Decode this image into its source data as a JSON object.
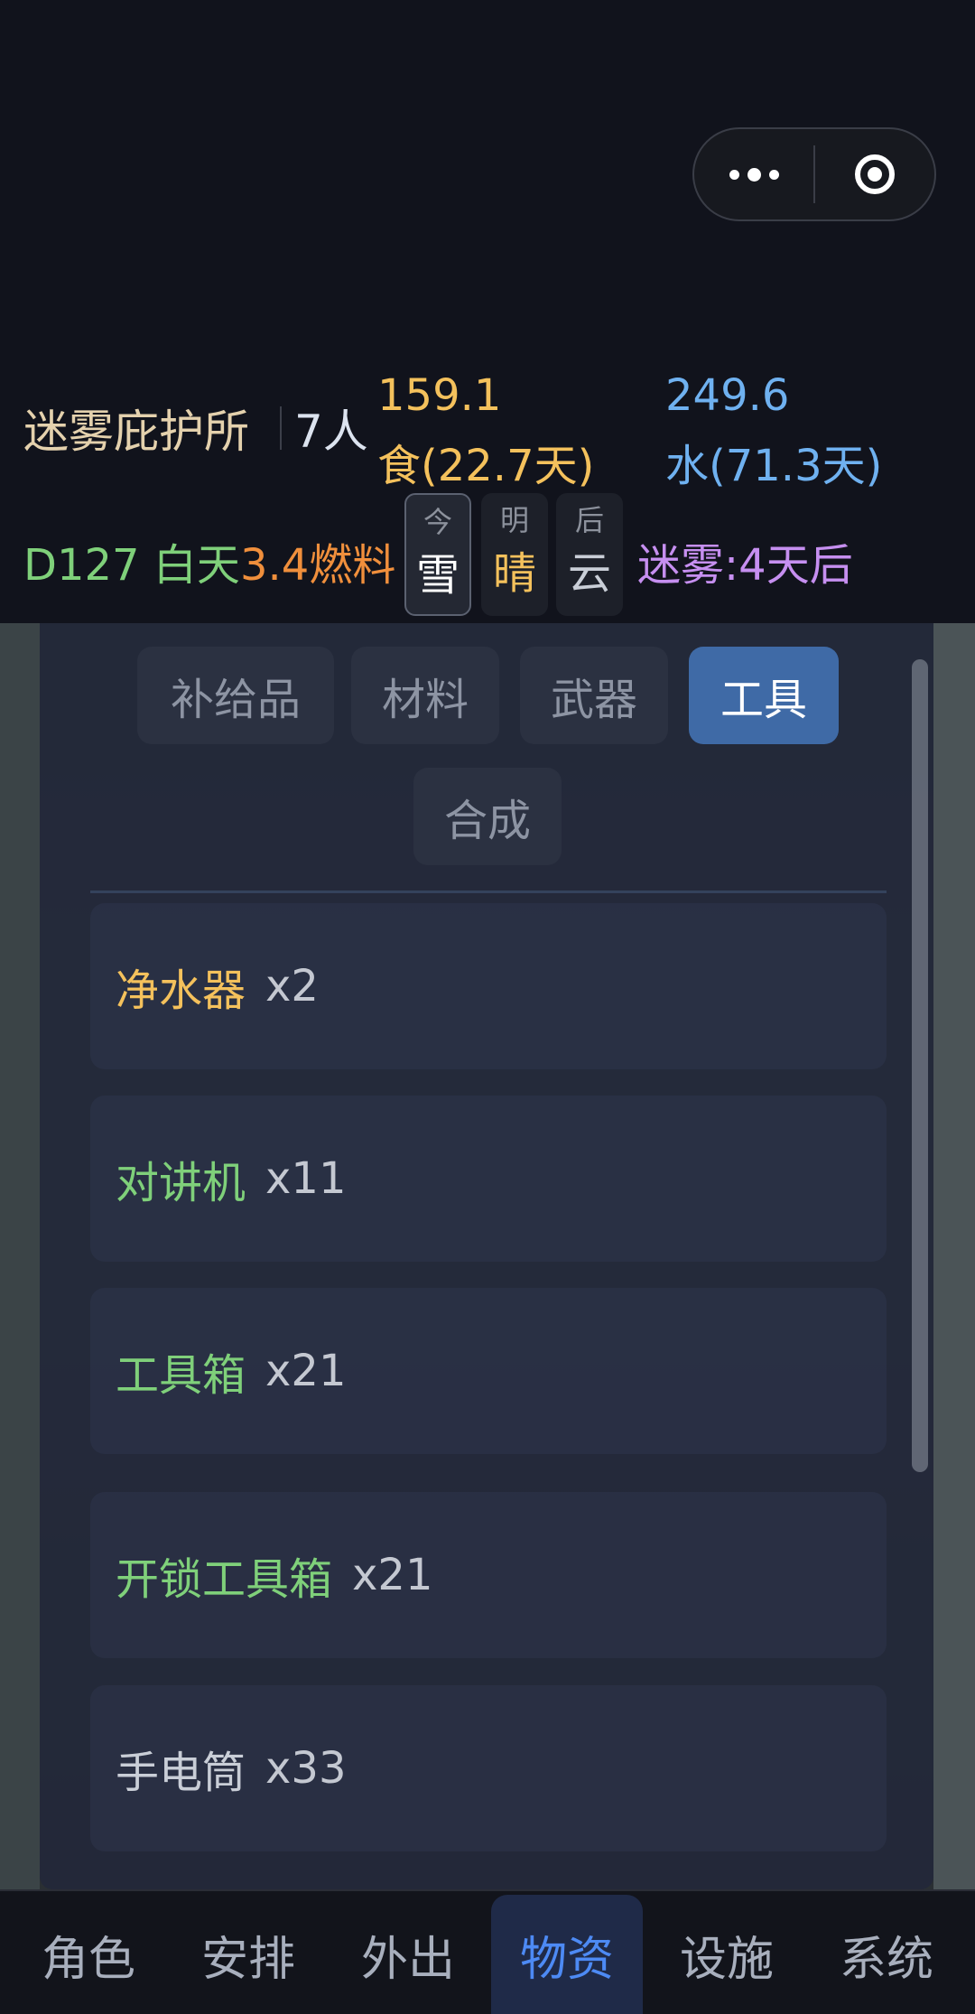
{
  "capsule": {
    "more_icon": "more-dots-icon",
    "close_icon": "target-close-icon"
  },
  "status": {
    "shelter_name": "迷雾庇护所",
    "people": "7人",
    "food_value": "159.1",
    "food_days": "食(22.7天)",
    "water_value": "249.6",
    "water_days": "水(71.3天)",
    "day": "D127 白天",
    "fuel": "3.4燃料",
    "weather": [
      {
        "label": "今",
        "value": "雪",
        "color": "#ffffff"
      },
      {
        "label": "明",
        "value": "晴",
        "color": "#f4c15c"
      },
      {
        "label": "后",
        "value": "云",
        "color": "#c9ced7"
      }
    ],
    "fog": "迷雾:4天后",
    "colors": {
      "food": "#f4c15c",
      "water": "#6fb1f0",
      "day": "#7fd07a",
      "fuel": "#f08f3c",
      "fog": "#c68ff0"
    }
  },
  "tabs": [
    "补给品",
    "材料",
    "武器",
    "工具",
    "合成"
  ],
  "active_tab": "工具",
  "items": [
    {
      "name": "净水器",
      "qty": "x2",
      "color": "#f4c15c"
    },
    {
      "name": "对讲机",
      "qty": "x11",
      "color": "#7fd07a"
    },
    {
      "name": "工具箱",
      "qty": "x21",
      "color": "#7fd07a"
    },
    {
      "name": "开锁工具箱",
      "qty": "x21",
      "color": "#7fd07a"
    },
    {
      "name": "手电筒",
      "qty": "x33",
      "color": "#c9ced7"
    }
  ],
  "nav": [
    "角色",
    "安排",
    "外出",
    "物资",
    "设施",
    "系统"
  ],
  "active_nav": "物资"
}
